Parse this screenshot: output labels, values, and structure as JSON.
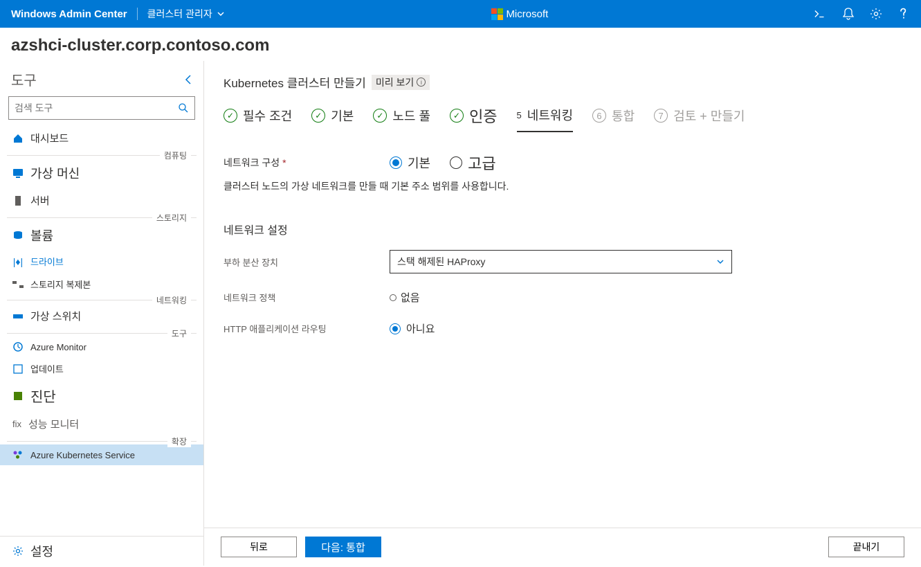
{
  "topbar": {
    "title": "Windows Admin Center",
    "context": "클러스터 관리자",
    "brand": "Microsoft"
  },
  "hostname": "azshci-cluster.corp.contoso.com",
  "sidebar": {
    "title": "도구",
    "search_placeholder": "검색 도구",
    "groups": {
      "compute": "컴퓨팅",
      "storage": "스토리지",
      "networking": "네트워킹",
      "tools": "도구",
      "extensions": "확장"
    },
    "items": {
      "dashboard": "대시보드",
      "vms": "가상 머신",
      "servers": "서버",
      "volumes": "볼륨",
      "drives": "드라이브",
      "storage_replica": "스토리지 복제본",
      "vswitch": "가상 스위치",
      "azure_monitor": "Azure Monitor",
      "updates": "업데이트",
      "diagnostics": "진단",
      "perf_monitor": "성능 모니터",
      "perf_prefix": "fix",
      "aks": "Azure Kubernetes Service",
      "settings": "설정"
    }
  },
  "page": {
    "title_prefix": "Kubernetes 클러스터 만들기",
    "preview_label": "미리 보기"
  },
  "wizard": {
    "s1": "필수 조건",
    "s2": "기본",
    "s3": "노드 풀",
    "s4": "인증",
    "s5": "네트워킹",
    "s5_num": "5",
    "s6": "통합",
    "s6_num": "6",
    "s7": "검토 + 만들기",
    "s7_num": "7"
  },
  "form": {
    "network_config_label": "네트워크 구성",
    "basic": "기본",
    "advanced": "고급",
    "config_desc": "클러스터 노드의 가상 네트워크를 만들 때 기본 주소 범위를 사용합니다.",
    "network_settings_title": "네트워크 설정",
    "load_balancer_label": "부하 분산 장치",
    "load_balancer_value": "스택 해제된 HAProxy",
    "network_policy_label": "네트워크 정책",
    "network_policy_value": "없음",
    "http_routing_label": "HTTP 애플리케이션 라우팅",
    "http_routing_value": "아니요"
  },
  "footer": {
    "back": "뒤로",
    "next": "다음: 통합",
    "finish": "끝내기"
  }
}
